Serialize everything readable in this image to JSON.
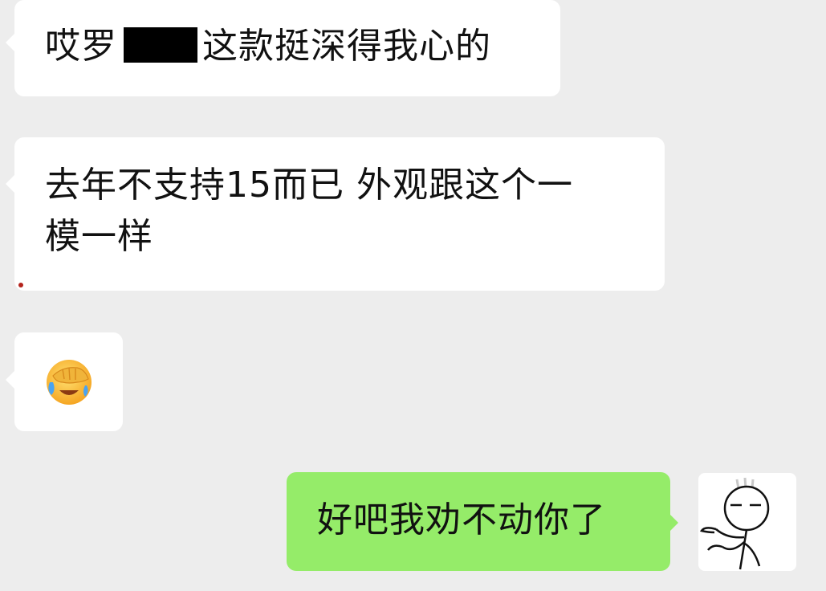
{
  "chat": {
    "messages": [
      {
        "side": "left",
        "text_before": "哎罗",
        "text_after": "这款挺深得我心的",
        "redacted": true
      },
      {
        "side": "left",
        "line1": "去年不支持15而已 外观跟这个一",
        "line2": "模一样"
      },
      {
        "side": "left",
        "emoji": "face-palm-emoji"
      },
      {
        "side": "right",
        "text": "好吧我劝不动你了"
      }
    ],
    "self_avatar": "stick-figure-shrug-avatar"
  },
  "colors": {
    "background": "#ededed",
    "incoming_bubble": "#ffffff",
    "outgoing_bubble": "#95ec69",
    "text": "#111111"
  }
}
